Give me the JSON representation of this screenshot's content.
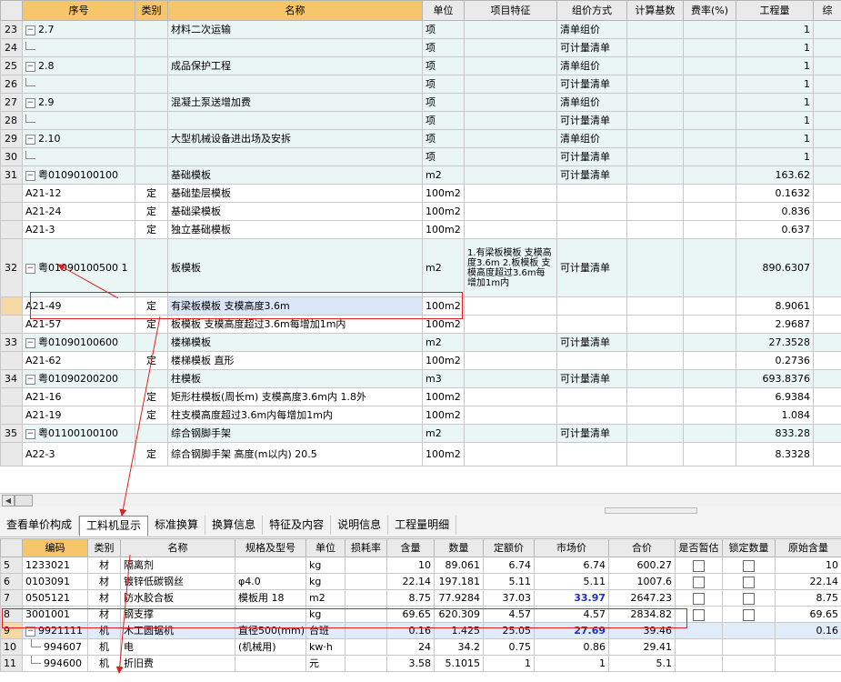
{
  "top_headers": [
    "序号",
    "类别",
    "名称",
    "单位",
    "项目特征",
    "组价方式",
    "计算基数",
    "费率(%)",
    "工程量",
    "综"
  ],
  "top_rows": [
    {
      "rn": "23",
      "seq": "2.7",
      "type": "",
      "name": "材料二次运输",
      "unit": "项",
      "feature": "",
      "method": "清单组价",
      "base": "",
      "rate": "",
      "qty": "1",
      "node": "toggle",
      "light": true
    },
    {
      "rn": "24",
      "seq": "",
      "type": "",
      "name": "",
      "unit": "项",
      "feature": "",
      "method": "可计量清单",
      "base": "",
      "rate": "",
      "qty": "1",
      "node": "branch",
      "light": true
    },
    {
      "rn": "25",
      "seq": "2.8",
      "type": "",
      "name": "成品保护工程",
      "unit": "项",
      "feature": "",
      "method": "清单组价",
      "base": "",
      "rate": "",
      "qty": "1",
      "node": "toggle",
      "light": true
    },
    {
      "rn": "26",
      "seq": "",
      "type": "",
      "name": "",
      "unit": "项",
      "feature": "",
      "method": "可计量清单",
      "base": "",
      "rate": "",
      "qty": "1",
      "node": "branch",
      "light": true
    },
    {
      "rn": "27",
      "seq": "2.9",
      "type": "",
      "name": "混凝土泵送增加费",
      "unit": "项",
      "feature": "",
      "method": "清单组价",
      "base": "",
      "rate": "",
      "qty": "1",
      "node": "toggle",
      "light": true
    },
    {
      "rn": "28",
      "seq": "",
      "type": "",
      "name": "",
      "unit": "项",
      "feature": "",
      "method": "可计量清单",
      "base": "",
      "rate": "",
      "qty": "1",
      "node": "branch",
      "light": true
    },
    {
      "rn": "29",
      "seq": "2.10",
      "type": "",
      "name": "大型机械设备进出场及安拆",
      "unit": "项",
      "feature": "",
      "method": "清单组价",
      "base": "",
      "rate": "",
      "qty": "1",
      "node": "toggle",
      "light": true
    },
    {
      "rn": "30",
      "seq": "",
      "type": "",
      "name": "",
      "unit": "项",
      "feature": "",
      "method": "可计量清单",
      "base": "",
      "rate": "",
      "qty": "1",
      "node": "branch",
      "light": true
    },
    {
      "rn": "31",
      "seq": "粤01090100100",
      "type": "",
      "name": "基础模板",
      "unit": "m2",
      "feature": "",
      "method": "可计量清单",
      "base": "",
      "rate": "",
      "qty": "163.62",
      "node": "toggle2",
      "light": true
    },
    {
      "rn": "",
      "seq": "A21-12",
      "type": "定",
      "name": "基础垫层模板",
      "unit": "100m2",
      "feature": "",
      "method": "",
      "base": "",
      "rate": "",
      "qty": "0.1632",
      "node": "leaf",
      "light": false
    },
    {
      "rn": "",
      "seq": "A21-24",
      "type": "定",
      "name": "基础梁模板",
      "unit": "100m2",
      "feature": "",
      "method": "",
      "base": "",
      "rate": "",
      "qty": "0.836",
      "node": "leaf",
      "light": false
    },
    {
      "rn": "",
      "seq": "A21-3",
      "type": "定",
      "name": "独立基础模板",
      "unit": "100m2",
      "feature": "",
      "method": "",
      "base": "",
      "rate": "",
      "qty": "0.637",
      "node": "leaf",
      "light": false
    },
    {
      "rn": "32",
      "seq": "粤01090100500 1",
      "type": "",
      "name": "板模板",
      "unit": "m2",
      "feature": "1.有梁板模板 支模高度3.6m 2.板模板 支模高度超过3.6m每增加1m内",
      "method": "可计量清单",
      "base": "",
      "rate": "",
      "qty": "890.6307",
      "node": "toggle2",
      "light": true,
      "tall": true
    },
    {
      "rn": "",
      "seq": "A21-49",
      "type": "定",
      "name": "有梁板模板 支模高度3.6m",
      "unit": "100m2",
      "feature": "",
      "method": "",
      "base": "",
      "rate": "",
      "qty": "8.9061",
      "node": "leaf",
      "light": false,
      "selected": true
    },
    {
      "rn": "",
      "seq": "A21-57",
      "type": "定",
      "name": "板模板 支模高度超过3.6m每增加1m内",
      "unit": "100m2",
      "feature": "",
      "method": "",
      "base": "",
      "rate": "",
      "qty": "2.9687",
      "node": "leaf",
      "light": false
    },
    {
      "rn": "33",
      "seq": "粤01090100600",
      "type": "",
      "name": "楼梯模板",
      "unit": "m2",
      "feature": "",
      "method": "可计量清单",
      "base": "",
      "rate": "",
      "qty": "27.3528",
      "node": "toggle2",
      "light": true
    },
    {
      "rn": "",
      "seq": "A21-62",
      "type": "定",
      "name": "楼梯模板 直形",
      "unit": "100m2",
      "feature": "",
      "method": "",
      "base": "",
      "rate": "",
      "qty": "0.2736",
      "node": "leaf",
      "light": false
    },
    {
      "rn": "34",
      "seq": "粤01090200200",
      "type": "",
      "name": "柱模板",
      "unit": "m3",
      "feature": "",
      "method": "可计量清单",
      "base": "",
      "rate": "",
      "qty": "693.8376",
      "node": "toggle2",
      "light": true
    },
    {
      "rn": "",
      "seq": "A21-16",
      "type": "定",
      "name": "矩形柱模板(周长m) 支模高度3.6m内 1.8外",
      "unit": "100m2",
      "feature": "",
      "method": "",
      "base": "",
      "rate": "",
      "qty": "6.9384",
      "node": "leaf",
      "light": false
    },
    {
      "rn": "",
      "seq": "A21-19",
      "type": "定",
      "name": "柱支模高度超过3.6m内每增加1m内",
      "unit": "100m2",
      "feature": "",
      "method": "",
      "base": "",
      "rate": "",
      "qty": "1.084",
      "node": "leaf",
      "light": false
    },
    {
      "rn": "35",
      "seq": "粤01100100100",
      "type": "",
      "name": "综合钢脚手架",
      "unit": "m2",
      "feature": "",
      "method": "可计量清单",
      "base": "",
      "rate": "",
      "qty": "833.28",
      "node": "toggle2",
      "light": true
    },
    {
      "rn": "",
      "seq": "A22-3",
      "type": "定",
      "name": "综合钢脚手架 高度(m以内) 20.5",
      "unit": "100m2",
      "feature": "",
      "method": "",
      "base": "",
      "rate": "",
      "qty": "8.3328",
      "node": "leaf",
      "light": false,
      "tallish": true
    }
  ],
  "tabs": [
    "查看单价构成",
    "工料机显示",
    "标准换算",
    "换算信息",
    "特征及内容",
    "说明信息",
    "工程量明细"
  ],
  "active_tab": 1,
  "bottom_headers": [
    "编码",
    "类别",
    "名称",
    "规格及型号",
    "单位",
    "损耗率",
    "含量",
    "数量",
    "定额价",
    "市场价",
    "合价",
    "是否暂估",
    "锁定数量",
    "原始含量"
  ],
  "bottom_rows": [
    {
      "rn": "5",
      "code": "1233021",
      "type": "材",
      "name": "隔离剂",
      "spec": "",
      "unit": "kg",
      "loss": "",
      "content": "10",
      "qty": "89.061",
      "quota": "6.74",
      "market": "6.74",
      "total": "600.27",
      "est": true,
      "lock": true,
      "orig": "10",
      "blue": false,
      "node": ""
    },
    {
      "rn": "6",
      "code": "0103091",
      "type": "材",
      "name": "镀锌低碳钢丝",
      "spec": "φ4.0",
      "unit": "kg",
      "loss": "",
      "content": "22.14",
      "qty": "197.181",
      "quota": "5.11",
      "market": "5.11",
      "total": "1007.6",
      "est": true,
      "lock": true,
      "orig": "22.14",
      "blue": false,
      "node": ""
    },
    {
      "rn": "7",
      "code": "0505121",
      "type": "材",
      "name": "防水胶合板",
      "spec": "模板用 18",
      "unit": "m2",
      "loss": "",
      "content": "8.75",
      "qty": "77.9284",
      "quota": "37.03",
      "market": "33.97",
      "total": "2647.23",
      "est": true,
      "lock": true,
      "orig": "8.75",
      "blue": true,
      "node": ""
    },
    {
      "rn": "8",
      "code": "3001001",
      "type": "材",
      "name": "钢支撑",
      "spec": "",
      "unit": "kg",
      "loss": "",
      "content": "69.65",
      "qty": "620.309",
      "quota": "4.57",
      "market": "4.57",
      "total": "2834.82",
      "est": true,
      "lock": true,
      "orig": "69.65",
      "blue": false,
      "node": ""
    },
    {
      "rn": "9",
      "code": "9921111",
      "type": "机",
      "name": "木工圆锯机",
      "spec": "直径500(mm)",
      "unit": "台班",
      "loss": "",
      "content": "0.16",
      "qty": "1.425",
      "quota": "25.05",
      "market": "27.69",
      "total": "39.46",
      "est": false,
      "lock": false,
      "orig": "0.16",
      "blue": true,
      "node": "toggle"
    },
    {
      "rn": "10",
      "code": "994607",
      "type": "机",
      "name": "电",
      "spec": "(机械用)",
      "unit": "kw·h",
      "loss": "",
      "content": "24",
      "qty": "34.2",
      "quota": "0.75",
      "market": "0.86",
      "total": "29.41",
      "est": false,
      "lock": false,
      "orig": "",
      "blue": false,
      "node": "branch"
    },
    {
      "rn": "11",
      "code": "994600",
      "type": "机",
      "name": "折旧费",
      "spec": "",
      "unit": "元",
      "loss": "",
      "content": "3.58",
      "qty": "5.1015",
      "quota": "1",
      "market": "1",
      "total": "5.1",
      "est": false,
      "lock": false,
      "orig": "",
      "blue": false,
      "node": "branch"
    }
  ],
  "colors": {
    "header_highlight": "#f5c66a",
    "row_light": "#eaf6f4",
    "annotation_red": "#e02020",
    "market_blue": "#1f2fcf"
  }
}
